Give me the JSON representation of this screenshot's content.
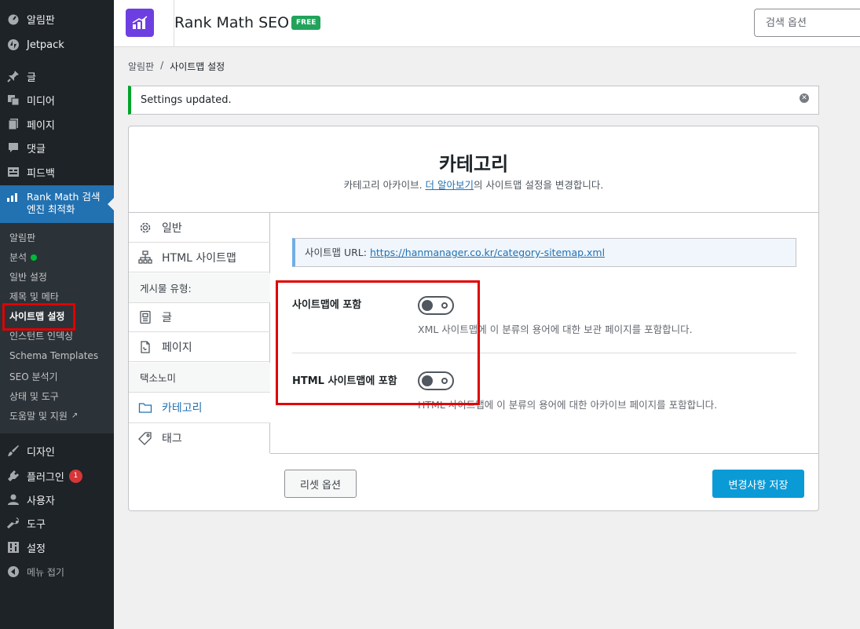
{
  "sidebar": {
    "top_items": [
      {
        "label": "알림판",
        "icon": "dashboard-icon"
      },
      {
        "label": "Jetpack",
        "icon": "jetpack-icon"
      }
    ],
    "content_items": [
      {
        "label": "글",
        "icon": "pin-icon"
      },
      {
        "label": "미디어",
        "icon": "media-icon"
      },
      {
        "label": "페이지",
        "icon": "pages-icon"
      },
      {
        "label": "댓글",
        "icon": "comments-icon"
      },
      {
        "label": "피드백",
        "icon": "feedback-icon"
      }
    ],
    "active": {
      "label": "Rank Math 검색 엔진 최적화",
      "icon": "rank-math-icon"
    },
    "submenu": [
      {
        "label": "알림판"
      },
      {
        "label": "분석"
      },
      {
        "label": "일반 설정"
      },
      {
        "label": "제목 및 메타"
      },
      {
        "label": "사이트맵 설정"
      },
      {
        "label": "인스턴트 인덱싱"
      },
      {
        "label": "Schema Templates"
      },
      {
        "label": "SEO 분석기"
      },
      {
        "label": "상태 및 도구"
      },
      {
        "label": "도움말 및 지원"
      }
    ],
    "bottom_items": [
      {
        "label": "디자인",
        "icon": "brush-icon"
      },
      {
        "label": "플러그인",
        "icon": "plugin-icon",
        "badge": "1"
      },
      {
        "label": "사용자",
        "icon": "user-icon"
      },
      {
        "label": "도구",
        "icon": "wrench-icon"
      },
      {
        "label": "설정",
        "icon": "settings-icon"
      },
      {
        "label": "메뉴 접기",
        "icon": "collapse-icon"
      }
    ]
  },
  "header": {
    "title": "Rank Math SEO",
    "badge": "FREE",
    "search_placeholder": "검색 옵션"
  },
  "breadcrumb": {
    "home": "알림판",
    "separator": "/",
    "current": "사이트맵 설정"
  },
  "notice": {
    "text": "Settings updated."
  },
  "panel": {
    "title": "카테고리",
    "desc_before": "카테고리 아카이브. ",
    "desc_link": "더 알아보기",
    "desc_after": "의 사이트맵 설정을 변경합니다.",
    "tabs": [
      {
        "label": "일반",
        "icon": "gear-icon"
      },
      {
        "label": "HTML 사이트맵",
        "icon": "sitemap-icon"
      },
      {
        "label": "게시물 유형:",
        "group": true
      },
      {
        "label": "글",
        "icon": "post-icon"
      },
      {
        "label": "페이지",
        "icon": "page-icon"
      },
      {
        "label": "택소노미",
        "group": true
      },
      {
        "label": "카테고리",
        "icon": "folder-icon",
        "active": true
      },
      {
        "label": "태그",
        "icon": "tag-icon"
      }
    ],
    "sitemap_url_label": "사이트맵 URL:",
    "sitemap_url": "https://hanmanager.co.kr/category-sitemap.xml",
    "options": [
      {
        "label": "사이트맵에 포함",
        "desc": "XML 사이트맵에 이 분류의 용어에 대한 보관 페이지를 포함합니다.",
        "enabled": false
      },
      {
        "label": "HTML 사이트맵에 포함",
        "desc": "HTML 사이트맵에 이 분류의 용어에 대한 아카이브 페이지를 포함합니다.",
        "enabled": false
      }
    ],
    "reset_label": "리셋 옵션",
    "save_label": "변경사항 저장"
  },
  "colors": {
    "accent": "#2271b1",
    "save_button": "#0a9bd7",
    "highlight": "#e00000",
    "brand": "#6e3fe0"
  }
}
